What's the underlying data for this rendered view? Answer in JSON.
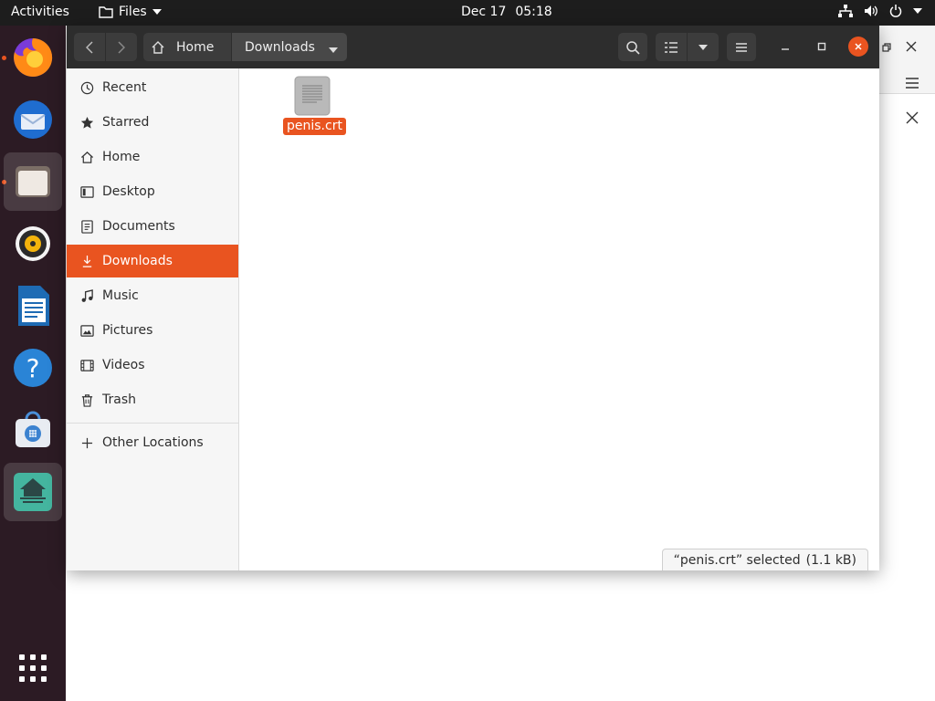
{
  "topbar": {
    "activities": "Activities",
    "app_menu": "Files",
    "date": "Dec 17",
    "time": "05:18"
  },
  "dock": {
    "items": [
      {
        "name": "firefox",
        "running": true
      },
      {
        "name": "thunderbird",
        "running": false
      },
      {
        "name": "files",
        "running": true,
        "active": true
      },
      {
        "name": "rhythmbox",
        "running": false
      },
      {
        "name": "libreoffice-writer",
        "running": false
      },
      {
        "name": "help",
        "running": false
      },
      {
        "name": "software",
        "running": false
      },
      {
        "name": "anki",
        "running": false
      }
    ],
    "show_apps_icon": "grid-icon"
  },
  "window": {
    "breadcrumb": {
      "home": "Home",
      "current": "Downloads"
    },
    "sidebar": {
      "items": [
        {
          "label": "Recent",
          "icon": "clock-icon"
        },
        {
          "label": "Starred",
          "icon": "star-icon"
        },
        {
          "label": "Home",
          "icon": "home-icon"
        },
        {
          "label": "Desktop",
          "icon": "desktop-icon"
        },
        {
          "label": "Documents",
          "icon": "document-icon"
        },
        {
          "label": "Downloads",
          "icon": "download-icon",
          "selected": true
        },
        {
          "label": "Music",
          "icon": "music-icon"
        },
        {
          "label": "Pictures",
          "icon": "picture-icon"
        },
        {
          "label": "Videos",
          "icon": "video-icon"
        },
        {
          "label": "Trash",
          "icon": "trash-icon"
        }
      ],
      "other_locations": "Other Locations"
    },
    "files": [
      {
        "name": "penis.crt",
        "selected": true
      }
    ],
    "status": {
      "selection": "“penis.crt” selected",
      "size": "(1.1 kB)"
    }
  },
  "colors": {
    "accent": "#e95420",
    "headerbar": "#2d2d2d",
    "dock": "#2c1b24"
  }
}
